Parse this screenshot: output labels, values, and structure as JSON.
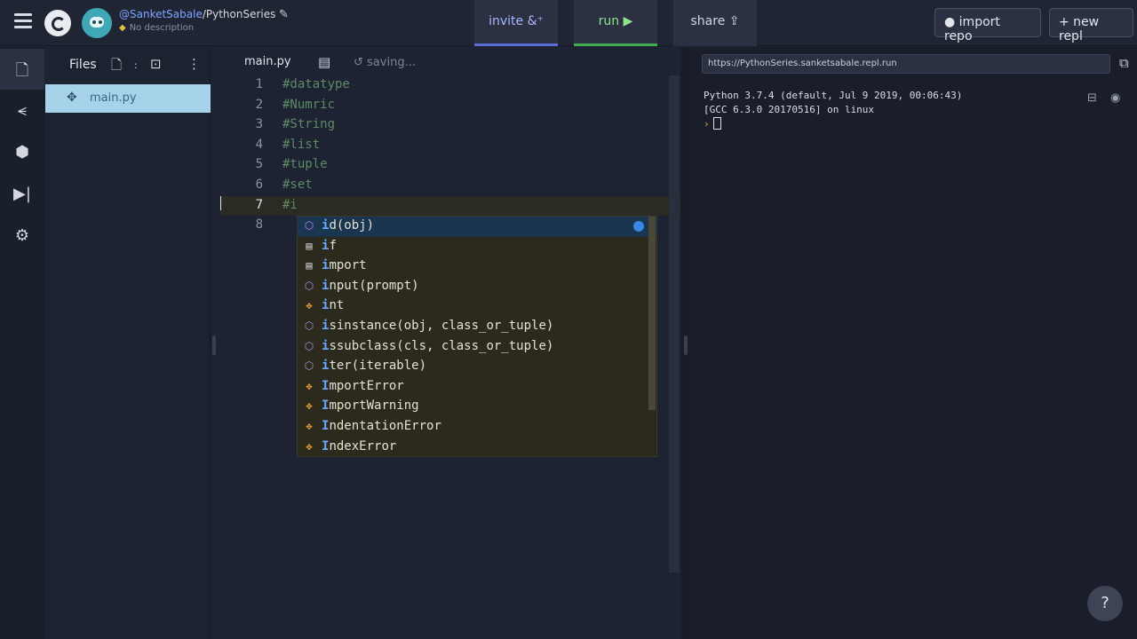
{
  "header": {
    "owner": "@SanketSabale",
    "project": "/PythonSeries",
    "description": "No description",
    "tabs": {
      "invite": "invite",
      "run": "run",
      "share": "share"
    },
    "invite_icon": " &⁺",
    "run_icon": " ▶",
    "share_icon": " ⇪",
    "import_repo": "import repo",
    "new_repl": "+ new repl"
  },
  "sidebar": {
    "icons": [
      "file-icon",
      "git-icon",
      "package-icon",
      "debugger-icon",
      "settings-icon"
    ]
  },
  "files": {
    "title": "Files",
    "items": [
      {
        "name": "main.py",
        "icon": "python-icon"
      }
    ]
  },
  "editor": {
    "tab": "main.py",
    "status": "saving...",
    "lines": [
      {
        "num": "1",
        "text": "#datatype"
      },
      {
        "num": "2",
        "text": "#Numric"
      },
      {
        "num": "3",
        "text": "#String"
      },
      {
        "num": "4",
        "text": "#list"
      },
      {
        "num": "5",
        "text": "#tuple"
      },
      {
        "num": "6",
        "text": "#set"
      },
      {
        "num": "7",
        "text": "#i"
      },
      {
        "num": "8",
        "text": ""
      }
    ],
    "current_line": 7
  },
  "autocomplete": {
    "items": [
      {
        "rest": "d(obj)",
        "kind": "function"
      },
      {
        "rest": "f",
        "kind": "keyword"
      },
      {
        "rest": "mport",
        "kind": "keyword"
      },
      {
        "rest": "nput(prompt)",
        "kind": "function"
      },
      {
        "rest": "nt",
        "kind": "class"
      },
      {
        "rest": "sinstance(obj, class_or_tuple)",
        "kind": "function"
      },
      {
        "rest": "ssubclass(cls, class_or_tuple)",
        "kind": "function"
      },
      {
        "rest": "ter(iterable)",
        "kind": "function"
      },
      {
        "rest": "mportError",
        "kind": "class",
        "match": "I"
      },
      {
        "rest": "mportWarning",
        "kind": "class",
        "match": "I"
      },
      {
        "rest": "ndentationError",
        "kind": "class",
        "match": "I"
      },
      {
        "rest": "ndexError",
        "kind": "class",
        "match": "I"
      }
    ],
    "match": "i"
  },
  "console": {
    "url": "https://PythonSeries.sanketsabale.repl.run",
    "line1": "Python 3.7.4 (default, Jul  9 2019, 00:06:43)",
    "line2": "[GCC 6.3.0 20170516] on linux",
    "prompt": "›"
  },
  "help": "?"
}
